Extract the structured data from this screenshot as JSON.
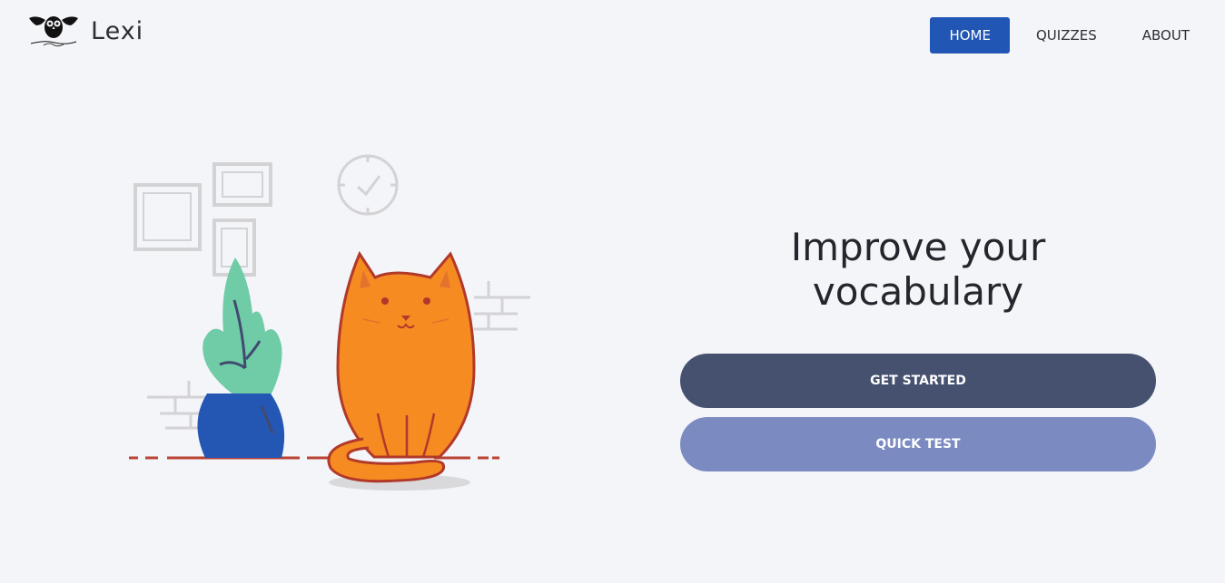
{
  "brand": {
    "name": "Lexi",
    "logo_icon": "owl-logo-icon"
  },
  "nav": {
    "items": [
      {
        "label": "HOME",
        "active": true
      },
      {
        "label": "QUIZZES",
        "active": false
      },
      {
        "label": "ABOUT",
        "active": false
      }
    ]
  },
  "hero": {
    "title": "Improve your vocabulary",
    "primary_button": "GET STARTED",
    "secondary_button": "QUICK TEST"
  },
  "illustration": {
    "subject": "cat-with-plant-illustration"
  },
  "colors": {
    "background": "#f4f5f9",
    "nav_active": "#2156b4",
    "primary_button": "#465170",
    "secondary_button": "#7b8bc1",
    "cat": "#f68b22",
    "plant_pot": "#2457b3",
    "plant_leaves": "#6fcca6"
  }
}
